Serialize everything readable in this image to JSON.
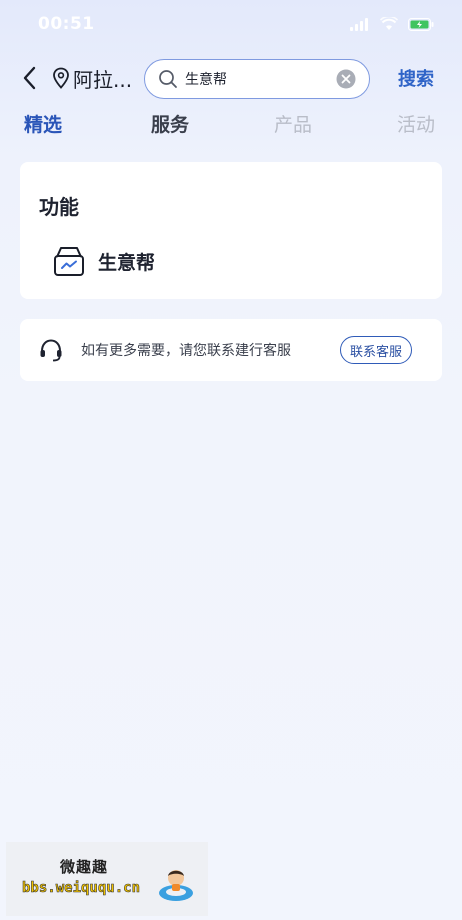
{
  "status_bar": {
    "time": "00:51"
  },
  "nav": {
    "location": "阿拉...",
    "search_value": "生意帮",
    "search_button": "搜索"
  },
  "tabs": [
    {
      "label": "精选",
      "active": true
    },
    {
      "label": "服务",
      "active": false
    },
    {
      "label": "产品",
      "active": false
    },
    {
      "label": "活动",
      "active": false
    }
  ],
  "function_section": {
    "title": "功能",
    "items": [
      {
        "label": "生意帮",
        "icon": "storefront-icon"
      }
    ]
  },
  "help": {
    "text": "如有更多需要，请您联系建行客服",
    "button": "联系客服",
    "icon": "headset-icon"
  },
  "watermark": {
    "title": "微趣趣",
    "url": "bbs.weiququ.cn"
  },
  "colors": {
    "accent": "#2f64c8",
    "tab_active": "#2a55b8",
    "tab_inactive": "#b9bdc8"
  }
}
